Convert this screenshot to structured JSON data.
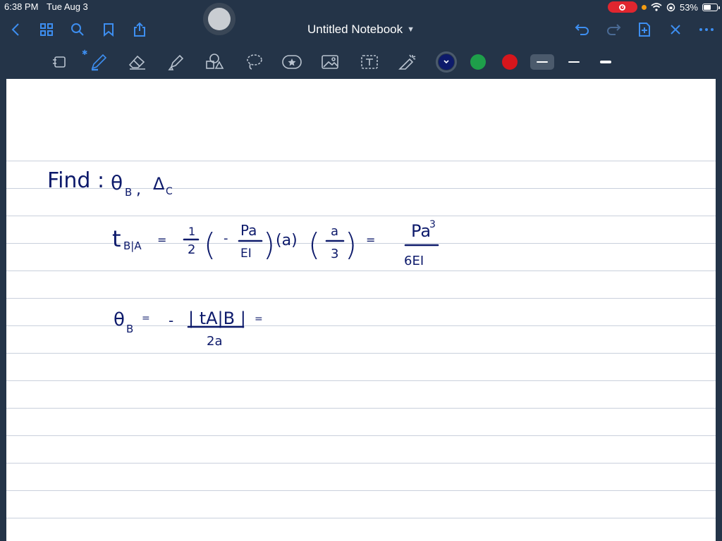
{
  "status": {
    "time": "6:38 PM",
    "date": "Tue Aug 3",
    "battery_percent": "53%",
    "battery_level": 0.53
  },
  "nav": {
    "title": "Untitled Notebook",
    "icons": [
      "back-chevron-icon",
      "thumbnails-grid-icon",
      "search-icon",
      "bookmark-icon",
      "share-icon",
      "undo-icon",
      "redo-icon",
      "add-page-icon",
      "close-icon",
      "more-icon"
    ]
  },
  "toolbar": {
    "tools": [
      "lasso-selection-icon",
      "pen-icon",
      "eraser-icon",
      "highlighter-icon",
      "shapes-icon",
      "lasso-icon",
      "sticker-icon",
      "image-icon",
      "text-icon",
      "laser-pointer-icon"
    ],
    "colors": [
      "#0d1a6b",
      "#1e9f4a",
      "#d6161c"
    ],
    "selected_color": "#0d1a6b",
    "stroke_widths": [
      "thin",
      "medium",
      "thick"
    ],
    "selected_stroke": "thin"
  },
  "notes": {
    "line1": {
      "find": "Find :",
      "theta_b": "θ",
      "sub_b": "B",
      "comma": ",",
      "delta_c": "Δ",
      "sub_c": "C"
    },
    "line2": {
      "t": "t",
      "sub_ba": "B|A",
      "eq1": "=",
      "half_num": "1",
      "half_den": "2",
      "lparen1": "(",
      "minus": "-",
      "pa_num": "Pa",
      "ei_den": "EI",
      "rparen1": ")",
      "a_paren": "(a)",
      "lparen2": "(",
      "a_num": "a",
      "three_den": "3",
      "rparen2": ")",
      "eq2": "=",
      "res_num": "Pa",
      "res_exp": "3",
      "res_den": "6EI"
    },
    "line3": {
      "theta": "θ",
      "sub_b": "B",
      "eq1": "=",
      "minus": "-",
      "abs_num": "| tA|B |",
      "den": "2a",
      "eq2": "="
    }
  }
}
